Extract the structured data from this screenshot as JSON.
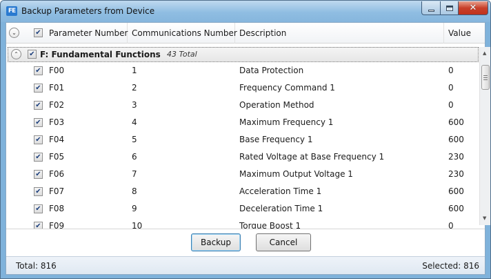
{
  "window": {
    "title": "Backup Parameters from Device",
    "icon": "app-logo-icon",
    "icon_label": "FE",
    "controls": {
      "minimize": "minimize-icon",
      "maximize": "maximize-icon",
      "close": "✕"
    }
  },
  "columns": {
    "expand_glyph": "⌄",
    "check_glyph": "✔",
    "parameter_number": "Parameter Number",
    "communications_number": "Communications Number",
    "description": "Description",
    "value": "Value"
  },
  "group": {
    "collapse_glyph": "⌃",
    "title": "F: Fundamental Functions",
    "count": "43 Total"
  },
  "rows": [
    {
      "param": "F00",
      "comm": "1",
      "desc": "Data Protection",
      "value": "0"
    },
    {
      "param": "F01",
      "comm": "2",
      "desc": "Frequency Command 1",
      "value": "0"
    },
    {
      "param": "F02",
      "comm": "3",
      "desc": "Operation Method",
      "value": "0"
    },
    {
      "param": "F03",
      "comm": "4",
      "desc": "Maximum Frequency 1",
      "value": "600"
    },
    {
      "param": "F04",
      "comm": "5",
      "desc": "Base Frequency 1",
      "value": "600"
    },
    {
      "param": "F05",
      "comm": "6",
      "desc": "Rated Voltage at Base Frequency 1",
      "value": "230"
    },
    {
      "param": "F06",
      "comm": "7",
      "desc": "Maximum Output Voltage 1",
      "value": "230"
    },
    {
      "param": "F07",
      "comm": "8",
      "desc": "Acceleration Time 1",
      "value": "600"
    },
    {
      "param": "F08",
      "comm": "9",
      "desc": "Deceleration Time 1",
      "value": "600"
    },
    {
      "param": "F09",
      "comm": "10",
      "desc": "Torque Boost 1",
      "value": "0"
    }
  ],
  "buttons": {
    "backup": "Backup",
    "cancel": "Cancel"
  },
  "status": {
    "total": "Total: 816",
    "selected": "Selected: 816"
  },
  "colors": {
    "accent": "#1c3f7c",
    "titlebar": "#8fbde2",
    "close": "#c0321c"
  }
}
